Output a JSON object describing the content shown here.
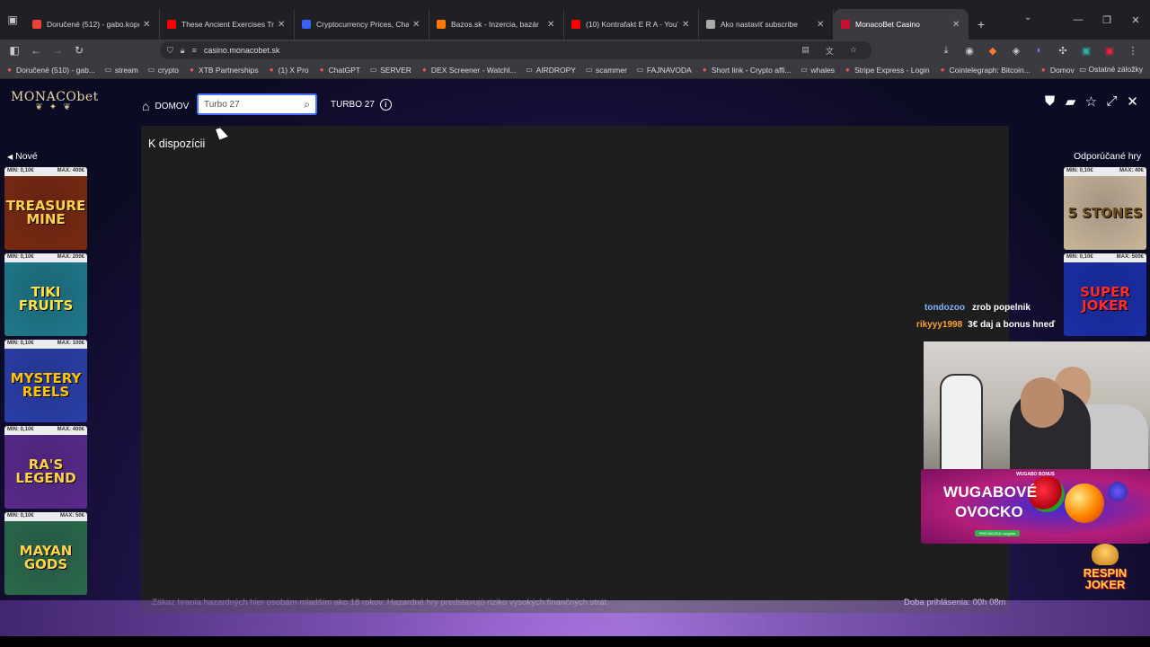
{
  "browser": {
    "tabs": [
      {
        "label": "Doručené (512) - gabo.kopcek@",
        "favicon": "gmail-icon",
        "color": "#ea4335",
        "active": false
      },
      {
        "label": "These Ancient Exercises Transfo",
        "favicon": "youtube-icon",
        "color": "#ff0000",
        "active": false
      },
      {
        "label": "Cryptocurrency Prices, Charts A",
        "favicon": "coinmarketcap-icon",
        "color": "#3861fb",
        "active": false
      },
      {
        "label": "Bazos.sk - Inzercia, bazár",
        "favicon": "bazos-icon",
        "color": "#ff7a00",
        "active": false
      },
      {
        "label": "(10) Kontrafakt E R A - YouT",
        "favicon": "youtube-icon",
        "color": "#ff0000",
        "active": false
      },
      {
        "label": "Ako nastaviť subscribe",
        "favicon": "chatgpt-icon",
        "color": "#aaaaaa",
        "active": false
      },
      {
        "label": "MonacoBet Casino",
        "favicon": "monacobet-icon",
        "color": "#c8102e",
        "active": true
      }
    ],
    "url": "casino.monacobet.sk",
    "bookmarks": [
      {
        "label": "Doručené (510) - gab...",
        "icon": "gmail-icon"
      },
      {
        "label": "stream",
        "icon": "folder-icon"
      },
      {
        "label": "crypto",
        "icon": "folder-icon"
      },
      {
        "label": "XTB Partnerships",
        "icon": "xtb-icon"
      },
      {
        "label": "(1) X Pro",
        "icon": "x-icon"
      },
      {
        "label": "ChatGPT",
        "icon": "chatgpt-icon"
      },
      {
        "label": "SERVER",
        "icon": "folder-icon"
      },
      {
        "label": "DEX Screener - Watchl...",
        "icon": "dexscreener-icon"
      },
      {
        "label": "AIRDROPY",
        "icon": "folder-icon"
      },
      {
        "label": "scammer",
        "icon": "folder-icon"
      },
      {
        "label": "FAJNAVODA",
        "icon": "folder-icon"
      },
      {
        "label": "Short link - Crypto affi...",
        "icon": "shortlink-icon"
      },
      {
        "label": "whales",
        "icon": "folder-icon"
      },
      {
        "label": "Stripe Express - Login",
        "icon": "stripe-icon"
      },
      {
        "label": "Cointelegraph: Bitcoin...",
        "icon": "cointelegraph-icon"
      },
      {
        "label": "Domov",
        "icon": "domov-icon"
      }
    ],
    "bookmarks_other": "Ostatné záložky"
  },
  "site": {
    "logo": "MONACObet",
    "nav_home": "DOMOV",
    "search_value": "Turbo 27",
    "turbo_label": "TURBO 27",
    "main_title": "K dispozícii",
    "left_section": "Nové",
    "right_section": "Odporúčané hry",
    "footer_warning": "Zákaz hrania hazardných hier osobám mladším ako 18 rokov. Hazardné hry predstavujú riziko vysokých finančných strát.",
    "session_time": "Doba prihlásenia: 00h 08m"
  },
  "left_games": [
    {
      "min": "MIN: 0,10€",
      "max": "MAX: 400€",
      "title": "TREASURE MINE",
      "bg": "#7a2a10",
      "fg": "#ffd24a"
    },
    {
      "min": "MIN: 0,10€",
      "max": "MAX: 200€",
      "title": "TIKI FRUITS",
      "bg": "#1f7a8a",
      "fg": "#ffe14a"
    },
    {
      "min": "MIN: 0,10€",
      "max": "MAX: 100€",
      "title": "MYSTERY REELS",
      "bg": "#2a3fa8",
      "fg": "#ffc400"
    },
    {
      "min": "MIN: 0,10€",
      "max": "MAX: 400€",
      "title": "RA'S LEGEND",
      "bg": "#5a2a8a",
      "fg": "#ffd24a"
    },
    {
      "min": "MIN: 0,10€",
      "max": "MAX: 50€",
      "title": "MAYAN GODS",
      "bg": "#2a6a4a",
      "fg": "#ffd24a"
    }
  ],
  "right_games": [
    {
      "min": "MIN: 0,10€",
      "max": "MAX: 40€",
      "title": "5 STONES",
      "bg": "#c9b79a",
      "fg": "#6a4a1a"
    },
    {
      "min": "MIN: 0,10€",
      "max": "MAX: 500€",
      "title": "SUPER JOKER",
      "bg": "#1a2fa8",
      "fg": "#ff2a2a"
    }
  ],
  "chat": [
    {
      "user": "tondozoo",
      "message": "zrob popelnik"
    },
    {
      "user": "rikyyy1998",
      "message": "3€ daj a bonus hneď"
    }
  ],
  "banner": {
    "tag": "WUGABO BONUS",
    "line1": "WUGABOVÉ",
    "line2": "OVOCKO",
    "cta": "PREVÁDZKA: wugabo"
  },
  "respin": {
    "line1": "RESPIN",
    "line2": "JOKER"
  }
}
